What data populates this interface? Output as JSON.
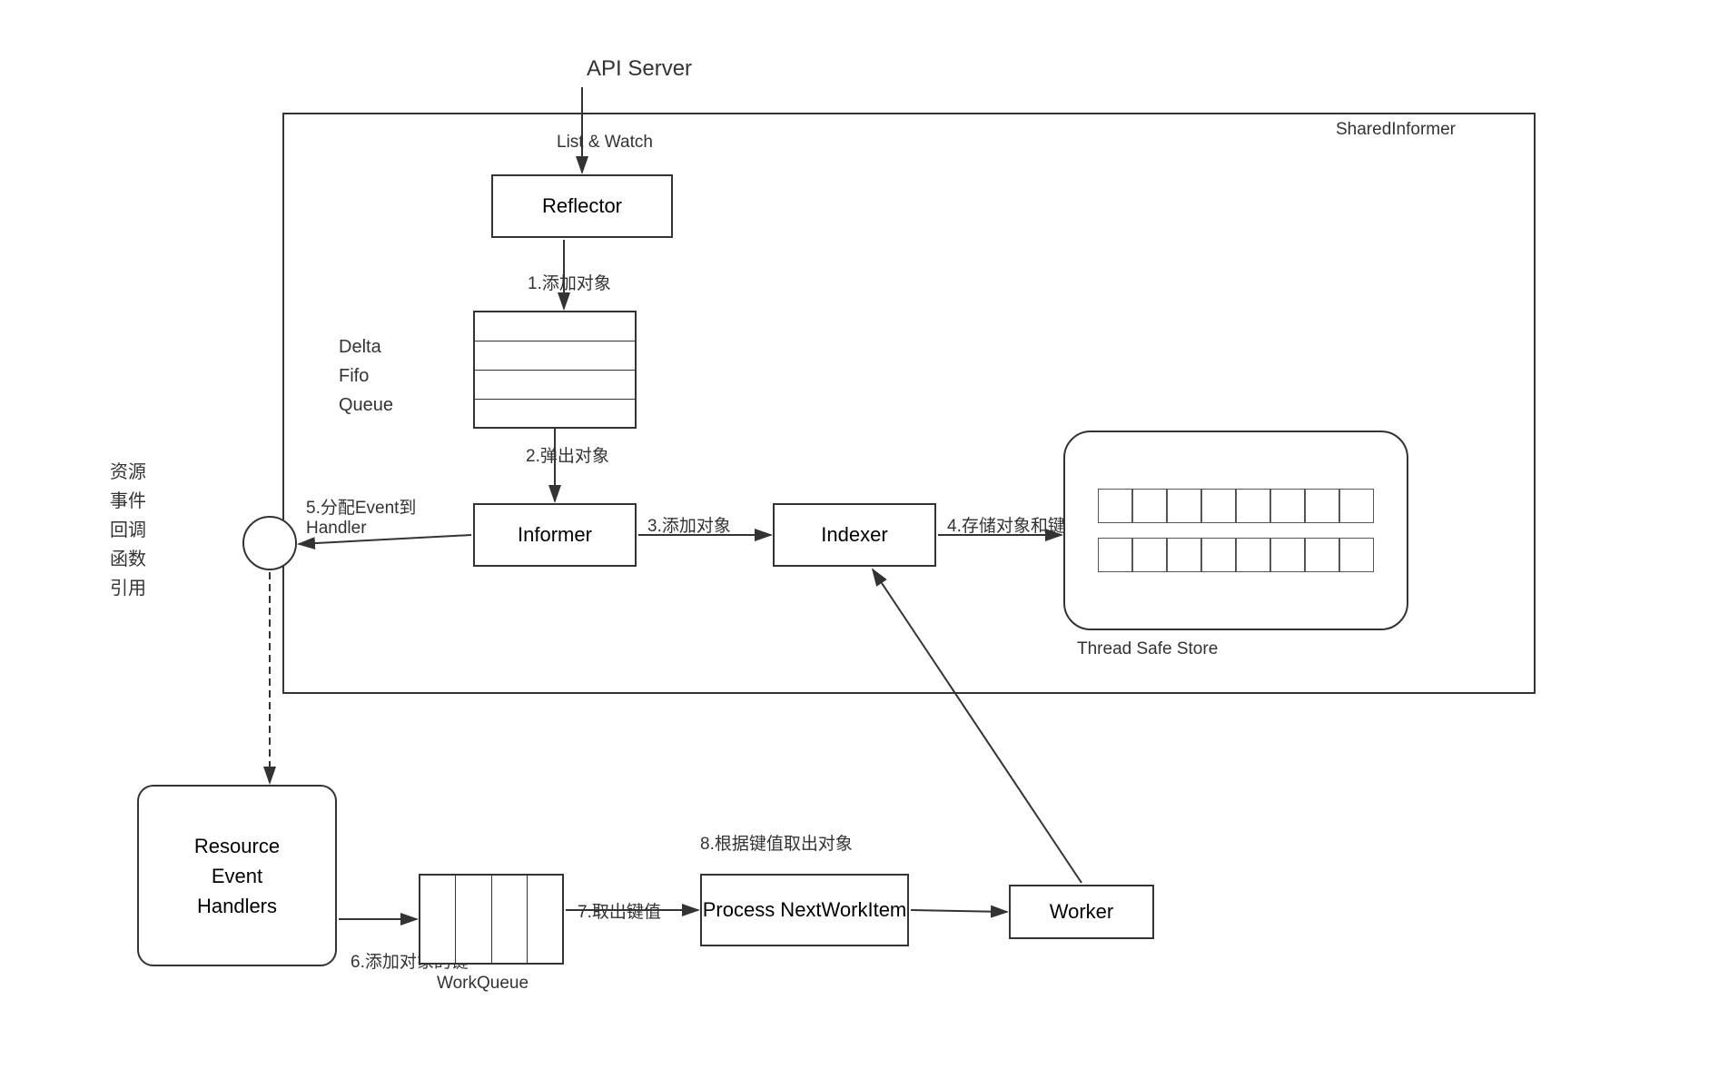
{
  "labels": {
    "api_server": "API Server",
    "list_watch": "List & Watch",
    "shared_informer": "SharedInformer",
    "reflector": "Reflector",
    "delta_fifo": "Delta\nFifo\nQueue",
    "delta_line1": "Delta",
    "delta_line2": "Fifo",
    "delta_line3": "Queue",
    "informer": "Informer",
    "indexer": "Indexer",
    "thread_safe_store": "Thread Safe Store",
    "resource_event_handlers": "Resource\nEvent\nHandlers",
    "workqueue": "WorkQueue",
    "process_next": "Process\nNextWorkItem",
    "worker": "Worker",
    "step1": "1.添加对象",
    "step2": "2.弹出对象",
    "step3": "3.添加对象",
    "step4": "4.存储对象和键",
    "step5": "5.分配Event到\nHandler",
    "step6": "6.添加对象的键",
    "step7": "7.取出键值",
    "step8": "8.根据键值取出对象",
    "resource_ref_label_1": "资源",
    "resource_ref_label_2": "事件",
    "resource_ref_label_3": "回调",
    "resource_ref_label_4": "函数",
    "resource_ref_label_5": "引用"
  }
}
